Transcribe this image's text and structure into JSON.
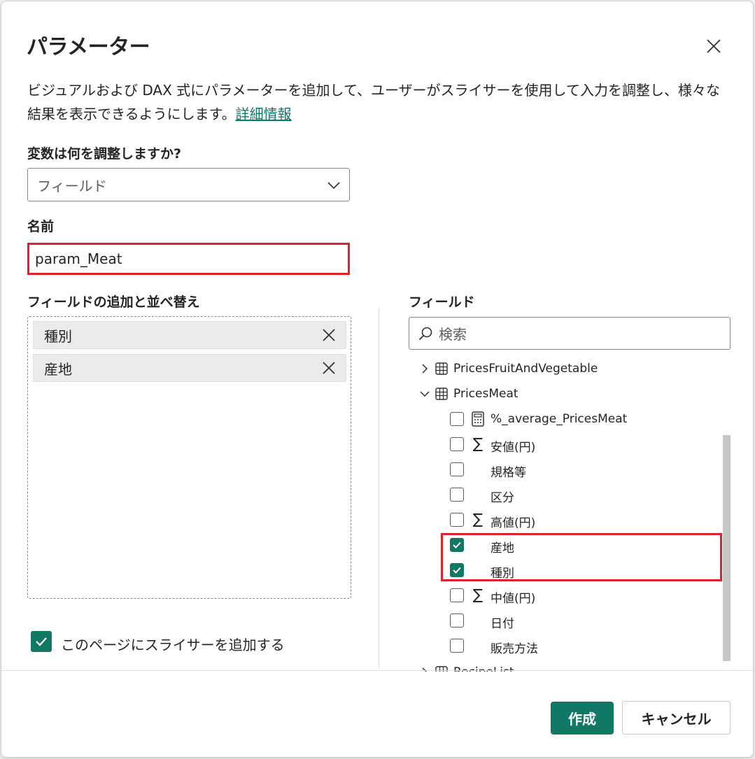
{
  "dialog": {
    "title": "パラメーター",
    "description": "ビジュアルおよび DAX 式にパラメーターを追加して、ユーザーがスライサーを使用して入力を調整し、様々な結果を表示できるようにします。",
    "learn_more": "詳細情報"
  },
  "variable": {
    "label": "変数は何を調整しますか?",
    "selected": "フィールド"
  },
  "name": {
    "label": "名前",
    "value": "param_Meat"
  },
  "field_list": {
    "label": "フィールドの追加と並べ替え",
    "items": [
      {
        "label": "種別"
      },
      {
        "label": "産地"
      }
    ]
  },
  "fields_pane": {
    "label": "フィールド",
    "search_placeholder": "検索",
    "tables": [
      {
        "name": "PricesFruitAndVegetable",
        "expanded": false
      },
      {
        "name": "PricesMeat",
        "expanded": true
      },
      {
        "name": "RecipeList",
        "expanded": false
      }
    ],
    "fields": [
      {
        "label": "%_average_PricesMeat",
        "icon": "calculator-icon",
        "checked": false
      },
      {
        "label": "安値(円)",
        "icon": "sigma-icon",
        "checked": false
      },
      {
        "label": "規格等",
        "icon": "",
        "checked": false
      },
      {
        "label": "区分",
        "icon": "",
        "checked": false
      },
      {
        "label": "高値(円)",
        "icon": "sigma-icon",
        "checked": false
      },
      {
        "label": "産地",
        "icon": "",
        "checked": true
      },
      {
        "label": "種別",
        "icon": "",
        "checked": true
      },
      {
        "label": "中値(円)",
        "icon": "sigma-icon",
        "checked": false
      },
      {
        "label": "日付",
        "icon": "",
        "checked": false
      },
      {
        "label": "販売方法",
        "icon": "",
        "checked": false
      }
    ]
  },
  "slicer_option": {
    "label": "このページにスライサーを追加する",
    "checked": true
  },
  "buttons": {
    "create": "作成",
    "cancel": "キャンセル"
  },
  "colors": {
    "accent": "#117865",
    "highlight": "#e0202e"
  }
}
